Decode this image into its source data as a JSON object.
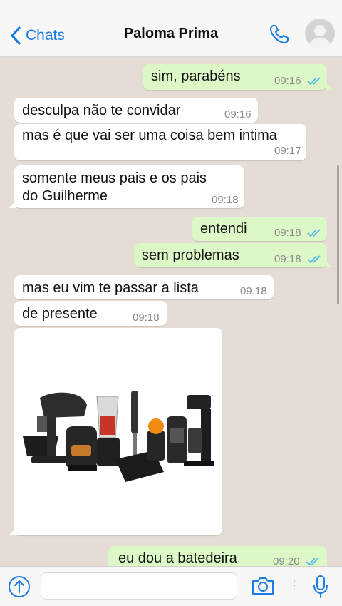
{
  "header": {
    "back_label": "Chats",
    "contact_name": "Paloma Prima"
  },
  "messages": [
    {
      "dir": "out",
      "text": "sim, parabéns",
      "time": "09:16",
      "read": true
    },
    {
      "dir": "in",
      "text": "desculpa não te convidar",
      "time": "09:16"
    },
    {
      "dir": "in",
      "text": "mas é que vai ser uma coisa bem intima",
      "time": "09:17"
    },
    {
      "dir": "in",
      "text_lines": [
        "somente meus pais e os pais",
        "do Guilherme"
      ],
      "time": "09:18"
    },
    {
      "dir": "out",
      "text": "entendi",
      "time": "09:18",
      "read": true
    },
    {
      "dir": "out",
      "text": "sem problemas",
      "time": "09:18",
      "read": true
    },
    {
      "dir": "in",
      "text": "mas eu vim te passar a lista",
      "time": "09:18"
    },
    {
      "dir": "in",
      "text": "de presente",
      "time": "09:18"
    },
    {
      "dir": "in",
      "type": "image",
      "image_description_icon": "kitchen-appliances-photo"
    },
    {
      "dir": "out",
      "text": "eu dou a batedeira",
      "time": "09:20",
      "read": true
    }
  ],
  "footer": {
    "input_placeholder": "",
    "icons": [
      "share-icon",
      "camera-icon",
      "more-icon",
      "microphone-icon"
    ]
  },
  "colors": {
    "accent": "#1a7ce6",
    "outgoing_bubble": "#dcf8c6",
    "incoming_bubble": "#ffffff",
    "chat_background": "#e5ddd5",
    "read_ticks": "#4fb6ec"
  }
}
